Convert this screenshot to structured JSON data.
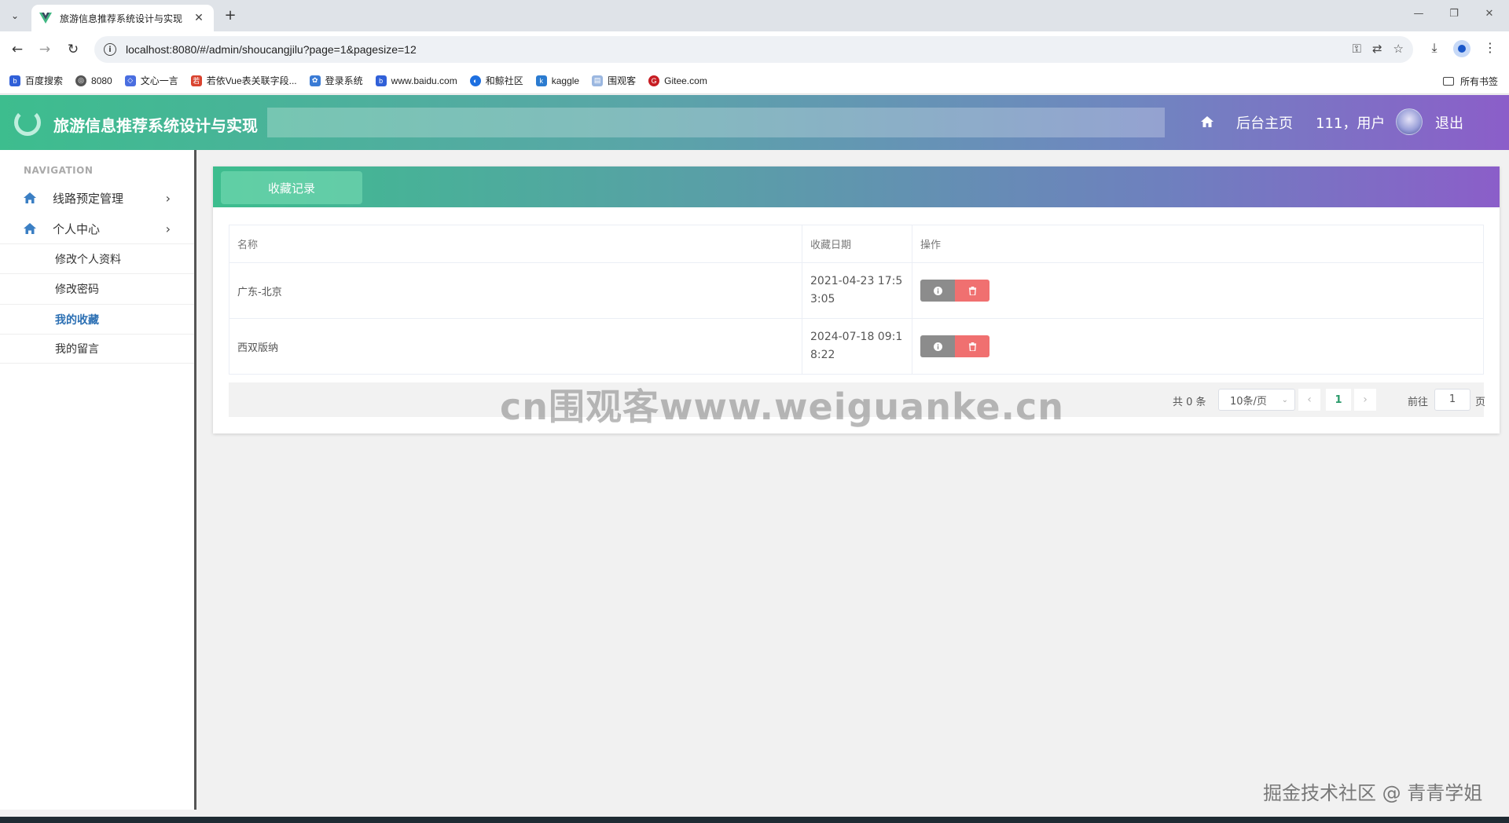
{
  "browser": {
    "tab_title": "旅游信息推荐系统设计与实现",
    "url": "localhost:8080/#/admin/shoucangjilu?page=1&pagesize=12",
    "bookmarks": [
      {
        "label": "百度搜索",
        "icon": "baidu-icon",
        "color": "#3060d8"
      },
      {
        "label": "8080",
        "icon": "globe-icon",
        "color": "#555555"
      },
      {
        "label": "文心一言",
        "icon": "wenxin-icon",
        "color": "#4a6ee0"
      },
      {
        "label": "若依Vue表关联字段...",
        "icon": "ruoyi-icon",
        "color": "#d9432f"
      },
      {
        "label": "登录系统",
        "icon": "lotus-icon",
        "color": "#3a7bd5"
      },
      {
        "label": "www.baidu.com",
        "icon": "baidu-icon",
        "color": "#3060d8"
      },
      {
        "label": "和鲸社区",
        "icon": "heywhale-icon",
        "color": "#1d6fe0"
      },
      {
        "label": "kaggle",
        "icon": "kaggle-icon",
        "color": "#2b7bd0"
      },
      {
        "label": "围观客",
        "icon": "page-icon",
        "color": "#9bb7e0"
      },
      {
        "label": "Gitee.com",
        "icon": "gitee-icon",
        "color": "#c71d23"
      }
    ],
    "all_bookmarks": "所有书签"
  },
  "header": {
    "title": "旅游信息推荐系统设计与实现",
    "home_label": "后台主页",
    "user_label": "111，用户",
    "logout_label": "退出"
  },
  "sidebar": {
    "heading": "NAVIGATION",
    "menus": [
      {
        "label": "线路预定管理",
        "icon": "home-icon"
      },
      {
        "label": "个人中心",
        "icon": "home-icon"
      }
    ],
    "sub_items": [
      {
        "label": "修改个人资料",
        "active": false
      },
      {
        "label": "修改密码",
        "active": false
      },
      {
        "label": "我的收藏",
        "active": true
      },
      {
        "label": "我的留言",
        "active": false
      }
    ]
  },
  "main": {
    "tab_label": "收藏记录",
    "columns": [
      "名称",
      "收藏日期",
      "操作"
    ],
    "rows": [
      {
        "name": "广东-北京",
        "date_line1": "2021-04-23 17:5",
        "date_line2": "3:05"
      },
      {
        "name": "西双版纳",
        "date_line1": "2024-07-18 09:1",
        "date_line2": "8:22"
      }
    ],
    "pagination": {
      "total": "共 0 条",
      "page_size": "10条/页",
      "current_page": "1",
      "goto_label": "前往",
      "goto_value": "1",
      "page_suffix": "页"
    }
  },
  "watermarks": {
    "center": "cn围观客www.weiguanke.cn",
    "corner": "掘金技术社区 @ 青青学姐"
  },
  "colors": {
    "accent_green": "#3dbd8e",
    "accent_purple": "#8b5ec9",
    "delete_red": "#f07070",
    "info_gray": "#8c8c8c"
  }
}
